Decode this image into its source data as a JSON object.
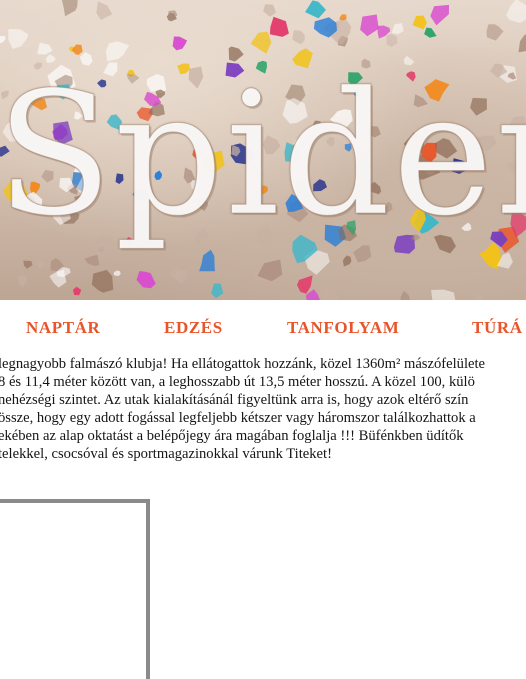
{
  "header": {
    "logo_text": "Spider"
  },
  "nav": {
    "items": [
      {
        "label": "NAPTÁR"
      },
      {
        "label": "EDZÉS"
      },
      {
        "label": "TANFOLYAM"
      },
      {
        "label": "TÚRÁ"
      }
    ],
    "color": "#e8552a"
  },
  "intro": {
    "lines": [
      "legnagyobb falmászó klubja! Ha ellátogattok hozzánk, közel 1360m² mászófelülete",
      "8 és 11,4 méter között van, a leghosszabb út 13,5 méter hosszú. A közel 100, külö",
      "nehézségi szintet. Az utak kialakításánál figyeltünk arra is, hogy azok eltérő szín",
      "össze, hogy egy adott fogással legfeljebb kétszer vagy háromszor találkozhattok a",
      "ekében az alap oktatást a belépőjegy ára magában foglalja !!! Büfénkben üdítők",
      "telekkel, csocsóval és sportmagazinokkal várunk Titeket!"
    ]
  }
}
